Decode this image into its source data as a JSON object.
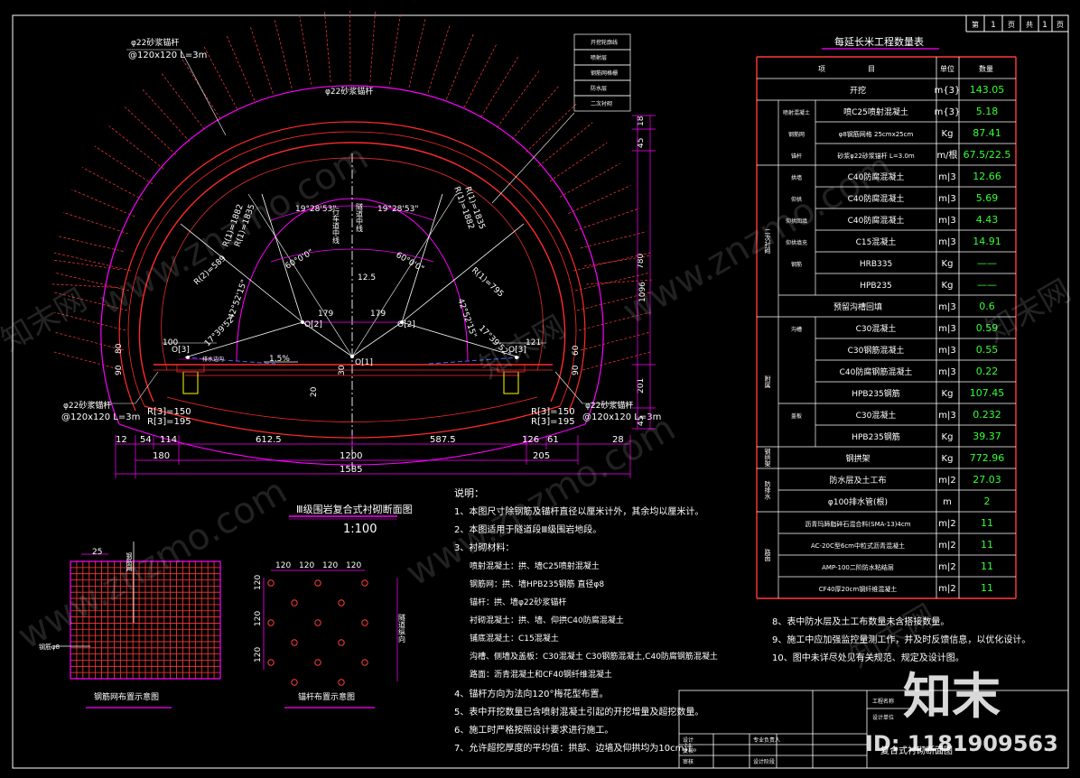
{
  "sheet": {
    "label_di": "第",
    "page_no": "1",
    "label_ye": "页",
    "label_gong": "共",
    "total_pages": "1",
    "label_ye2": "页"
  },
  "section": {
    "anchor_top": "φ22砂浆锚杆",
    "anchor_top_spec": "@120x120 L=3m",
    "anchor_crown": "φ22砂浆锚杆",
    "anchor_left": "φ22砂浆锚杆",
    "anchor_left_spec": "@120x120 L=3m",
    "anchor_right": "φ22砂浆锚杆",
    "anchor_right_spec": "@120x120 L=3m",
    "layers": [
      "开挖轮廓线",
      "喷射层",
      "钢筋网格栅",
      "防水层",
      "二次衬砌"
    ],
    "angle_left": "19°28'53\"",
    "angle_right": "19°28'53\"",
    "angle_60_left": "60°0'0\"",
    "angle_60_right": "60°0'0\"",
    "angle_42_left": "42°52'15\"",
    "angle_42_right": "42°52'15\"",
    "angle_17_left": "17°39'52\"",
    "angle_17_right": "17°39'52\"",
    "r1_left": "R(1)=795",
    "r1_right": "R(1)=795",
    "r2_left": "R(2)=589",
    "r2_right": "R(2)=589",
    "rr1_left": "R(1)=1882",
    "rr1_right": "R(1)=1882",
    "rr2_left": "R(1)=1835",
    "rr2_right": "R(1)=1835",
    "r3_left_a": "R[3]=150",
    "r3_left_b": "R[3]=195",
    "r3_right_a": "R[3]=150",
    "r3_right_b": "R[3]=195",
    "center_text": "行车道中线",
    "tunnel_text": "隧道中线",
    "o1": "O[1]",
    "o2_left": "O[2]",
    "o2_right": "O[2]",
    "o3_left": "O[3]",
    "o3_right": "O[3]",
    "slope": "1.5%",
    "drain": "排水边沟",
    "d_12_5": "12.5",
    "d_179_l": "179",
    "d_179_r": "179",
    "d_100": "100",
    "d_121": "121",
    "d_30": "30",
    "d_20": "20",
    "d_80": "80",
    "d_90": "90",
    "d_60": "60",
    "d_90_r": "90",
    "d_18": "18",
    "d_45_top": "45",
    "d_780": "780",
    "d_1096": "1096",
    "d_201": "201",
    "d_45_bot": "45",
    "bottom_dims_row1": [
      "12",
      "54",
      "114",
      "612.5",
      "587.5",
      "126",
      "61",
      "28"
    ],
    "bottom_180": "180",
    "bottom_1200": "1200",
    "bottom_205": "205",
    "bottom_1585": "1585"
  },
  "section_title": "Ⅲ级围岩复合式衬砌断面图",
  "section_scale": "1:100",
  "mesh": {
    "title": "钢筋网布置示意图",
    "dim": "25",
    "label_v": "钢筋网",
    "label_h": "钢筋φ8"
  },
  "anchor_layout": {
    "title": "锚杆布置示意图",
    "dims_top": [
      "120",
      "120",
      "120",
      "120"
    ],
    "dims_left": [
      "120",
      "120",
      "120"
    ],
    "label": "隧道纵向"
  },
  "notes": {
    "heading": "说明：",
    "lines": [
      "1、本图尺寸除钢筋及锚杆直径以厘米计外，其余均以厘米计。",
      "2、本图适用于隧道段Ⅲ级围岩地段。",
      "3、衬砌材料：",
      "喷射混凝土：拱、墙C25喷射混凝土",
      "钢筋网：拱、墙HPB235钢筋  直径φ8",
      "锚杆：拱、墙φ22砂浆锚杆",
      "衬砌混凝土：拱、墙、仰拱C40防腐混凝土",
      "铺底混凝土：C15混凝土",
      "沟槽、侧墙及盖板：C30混凝土 C30钢筋混凝土,C40防腐钢筋混凝土",
      "路面：沥青混凝土和CF40钢纤维混凝土",
      "4、锚杆方向为法向120°梅花型布置。",
      "5、表中开挖数量已含喷射混凝土引起的开挖增量及超挖数量。",
      "6、施工时严格按照设计要求进行施工。",
      "7、允许超挖厚度的平均值：拱部、边墙及仰拱均为10cm计。",
      "8、表中防水层及土工布数量未含搭接数量。",
      "9、施工中应加强监控量测工作，并及时反馈信息，以优化设计。",
      "10、图中未详尽处见有关规范、规定及设计图。"
    ]
  },
  "table": {
    "title": "每延长米工程数量表",
    "header": [
      "项",
      "目",
      "单位",
      "数量"
    ],
    "rows": [
      {
        "g1": "",
        "g2": "",
        "item": "开挖",
        "unit": "m{3}",
        "qty": "143.05"
      },
      {
        "g1": "初期支护",
        "g2": "喷射混凝土",
        "item": "喷C25喷射混凝土",
        "unit": "m{3}",
        "qty": "5.18"
      },
      {
        "g1": "",
        "g2": "钢筋网",
        "item": "φ8钢筋网格 25cmx25cm",
        "unit": "Kg",
        "qty": "87.41"
      },
      {
        "g1": "",
        "g2": "锚杆",
        "item": "砂浆φ22砂浆锚杆 L=3.0m",
        "unit": "m/根",
        "qty": "67.5/22.5"
      },
      {
        "g1": "二次衬砌",
        "g2": "拱墙",
        "item": "C40防腐混凝土",
        "unit": "m|3",
        "qty": "12.66"
      },
      {
        "g1": "",
        "g2": "仰拱",
        "item": "C40防腐混凝土",
        "unit": "m|3",
        "qty": "5.69"
      },
      {
        "g1": "",
        "g2": "仰拱回填",
        "item": "C40防腐混凝土",
        "unit": "m|3",
        "qty": "4.43"
      },
      {
        "g1": "",
        "g2": "仰拱填充",
        "item": "C15混凝土",
        "unit": "m|3",
        "qty": "14.91"
      },
      {
        "g1": "",
        "g2": "钢筋",
        "item": "HRB335",
        "unit": "Kg",
        "qty": "——"
      },
      {
        "g1": "",
        "g2": "",
        "item": "HPB235",
        "unit": "Kg",
        "qty": "——"
      },
      {
        "g1": "",
        "g2": "",
        "item": "预留沟槽回填",
        "unit": "m|3",
        "qty": "0.6"
      },
      {
        "g1": "附属",
        "g2": "沟槽",
        "item": "C30混凝土",
        "unit": "m|3",
        "qty": "0.59"
      },
      {
        "g1": "",
        "g2": "",
        "item": "C30钢筋混凝土",
        "unit": "m|3",
        "qty": "0.55"
      },
      {
        "g1": "",
        "g2": "",
        "item": "C40防腐钢筋混凝土",
        "unit": "m|3",
        "qty": "0.22"
      },
      {
        "g1": "",
        "g2": "",
        "item": "HPB235钢筋",
        "unit": "Kg",
        "qty": "107.45"
      },
      {
        "g1": "",
        "g2": "盖板",
        "item": "C30混凝土",
        "unit": "m|3",
        "qty": "0.232"
      },
      {
        "g1": "",
        "g2": "",
        "item": "HPB235钢筋",
        "unit": "Kg",
        "qty": "39.37"
      },
      {
        "g1": "钢拱架",
        "g2": "",
        "item": "钢拱架",
        "unit": "Kg",
        "qty": "772.96"
      },
      {
        "g1": "防排水",
        "g2": "",
        "item": "防水层及土工布",
        "unit": "m|2",
        "qty": "27.03"
      },
      {
        "g1": "",
        "g2": "",
        "item": "φ100排水管(根)",
        "unit": "m",
        "qty": "2"
      },
      {
        "g1": "路面",
        "g2": "",
        "item": "沥青玛蹄脂碎石混合料(SMA-13)4cm",
        "unit": "m|2",
        "qty": "11"
      },
      {
        "g1": "",
        "g2": "",
        "item": "AC-20C型6cm中粒式沥青混凝土",
        "unit": "m|2",
        "qty": "11"
      },
      {
        "g1": "",
        "g2": "",
        "item": "AMP-100二阶防水粘结层",
        "unit": "m|2",
        "qty": "11"
      },
      {
        "g1": "",
        "g2": "",
        "item": "CF40厚20cm钢纤维混凝土",
        "unit": "m|2",
        "qty": "11"
      }
    ]
  },
  "title_block": {
    "r1": "工程名称",
    "r2": "设计单位",
    "r3a": "设计",
    "r3b": "复核",
    "r3c": "审核",
    "r3d": "专业负责人",
    "r4a": "设计阶段",
    "drawing_title": "复合式衬砌断面图"
  },
  "watermark": {
    "logo": "知末",
    "id": "ID: 1181909563",
    "site": "www.znzmo.com",
    "cn": "知末网"
  }
}
